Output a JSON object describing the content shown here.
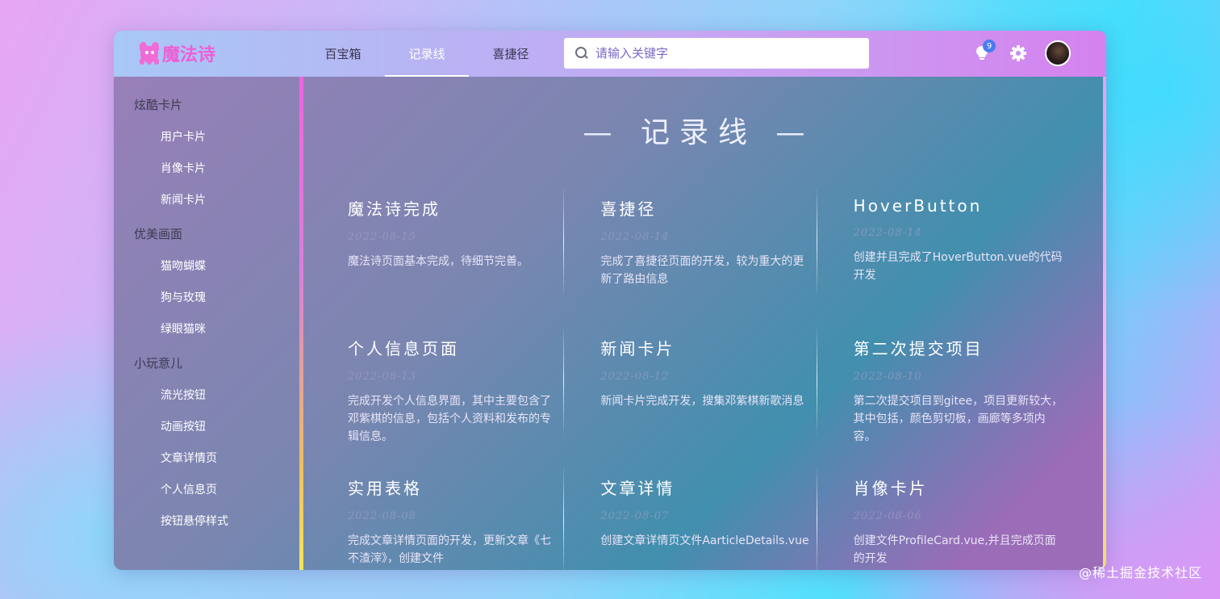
{
  "app": {
    "name": "魔法诗"
  },
  "nav": {
    "items": [
      {
        "label": "百宝箱",
        "active": false
      },
      {
        "label": "记录线",
        "active": true
      },
      {
        "label": "喜捷径",
        "active": false
      }
    ]
  },
  "search": {
    "placeholder": "请输入关键字",
    "value": ""
  },
  "notifications": {
    "count": "9"
  },
  "colors": {
    "logo": "#ee5fd6",
    "badge": "#4a7cf0",
    "accent": "#ffffff"
  },
  "sidebar": {
    "groups": [
      {
        "title": "炫酷卡片",
        "items": [
          "用户卡片",
          "肖像卡片",
          "新闻卡片"
        ]
      },
      {
        "title": "优美画面",
        "items": [
          "猫吻蝴蝶",
          "狗与玫瑰",
          "绿眼猫咪"
        ]
      },
      {
        "title": "小玩意儿",
        "items": [
          "流光按钮",
          "动画按钮",
          "文章详情页",
          "个人信息页",
          "按钮悬停样式"
        ]
      }
    ]
  },
  "main": {
    "title": "— 记录线 —",
    "entries": [
      {
        "title": "魔法诗完成",
        "date": "2022-08-15",
        "desc": "魔法诗页面基本完成，待细节完善。"
      },
      {
        "title": "喜捷径",
        "date": "2022-08-14",
        "desc": "完成了喜捷径页面的开发，较为重大的更新了路由信息"
      },
      {
        "title": "HoverButton",
        "date": "2022-08-14",
        "desc": "创建并且完成了HoverButton.vue的代码开发"
      },
      {
        "title": "个人信息页面",
        "date": "2022-08-13",
        "desc": "完成开发个人信息界面，其中主要包含了邓紫棋的信息，包括个人资料和发布的专辑信息。"
      },
      {
        "title": "新闻卡片",
        "date": "2022-08-12",
        "desc": "新闻卡片完成开发，搜集邓紫棋新歌消息"
      },
      {
        "title": "第二次提交项目",
        "date": "2022-08-10",
        "desc": "第二次提交项目到gitee，项目更新较大，其中包括，颜色剪切板，画廊等多项内容。"
      },
      {
        "title": "实用表格",
        "date": "2022-08-08",
        "desc": "完成文章详情页面的开发，更新文章《七不渣滓》，创建文件"
      },
      {
        "title": "文章详情",
        "date": "2022-08-07",
        "desc": "创建文章详情页文件AarticleDetails.vue"
      },
      {
        "title": "肖像卡片",
        "date": "2022-08-06",
        "desc": "创建文件ProfileCard.vue,并且完成页面的开发"
      }
    ]
  },
  "watermark": "@稀土掘金技术社区"
}
